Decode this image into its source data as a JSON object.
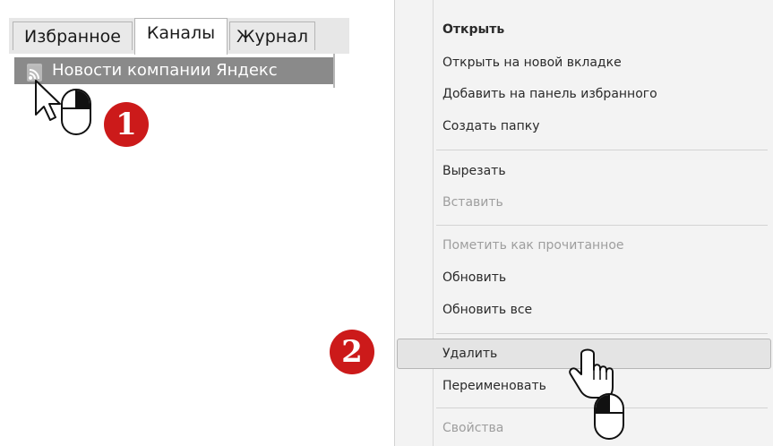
{
  "tabs": [
    {
      "label": "Избранное"
    },
    {
      "label": "Каналы"
    },
    {
      "label": "Журнал"
    }
  ],
  "feed": {
    "item_label": "Новости компании Яндекс",
    "icon": "rss-icon"
  },
  "steps": {
    "first": "1",
    "second": "2"
  },
  "context_menu": {
    "items": [
      {
        "label": "Открыть",
        "bold": true,
        "enabled": true
      },
      {
        "label": "Открыть на новой вкладке",
        "bold": false,
        "enabled": true
      },
      {
        "label": "Добавить на панель избранного",
        "bold": false,
        "enabled": true
      },
      {
        "label": "Создать папку",
        "bold": false,
        "enabled": true
      },
      {
        "label": "Вырезать",
        "bold": false,
        "enabled": true
      },
      {
        "label": "Вставить",
        "bold": false,
        "enabled": false
      },
      {
        "label": "Пометить как прочитанное",
        "bold": false,
        "enabled": false
      },
      {
        "label": "Обновить",
        "bold": false,
        "enabled": true
      },
      {
        "label": "Обновить все",
        "bold": false,
        "enabled": true
      },
      {
        "label": "Удалить",
        "bold": false,
        "enabled": true,
        "highlighted": true
      },
      {
        "label": "Переименовать",
        "bold": false,
        "enabled": true
      },
      {
        "label": "Свойства",
        "bold": false,
        "enabled": false
      }
    ]
  },
  "colors": {
    "badge": "#cc1a1a",
    "selected_row": "#8a8a8a",
    "menu_background": "#f3f3f3",
    "disabled_text": "#9e9e9e"
  }
}
